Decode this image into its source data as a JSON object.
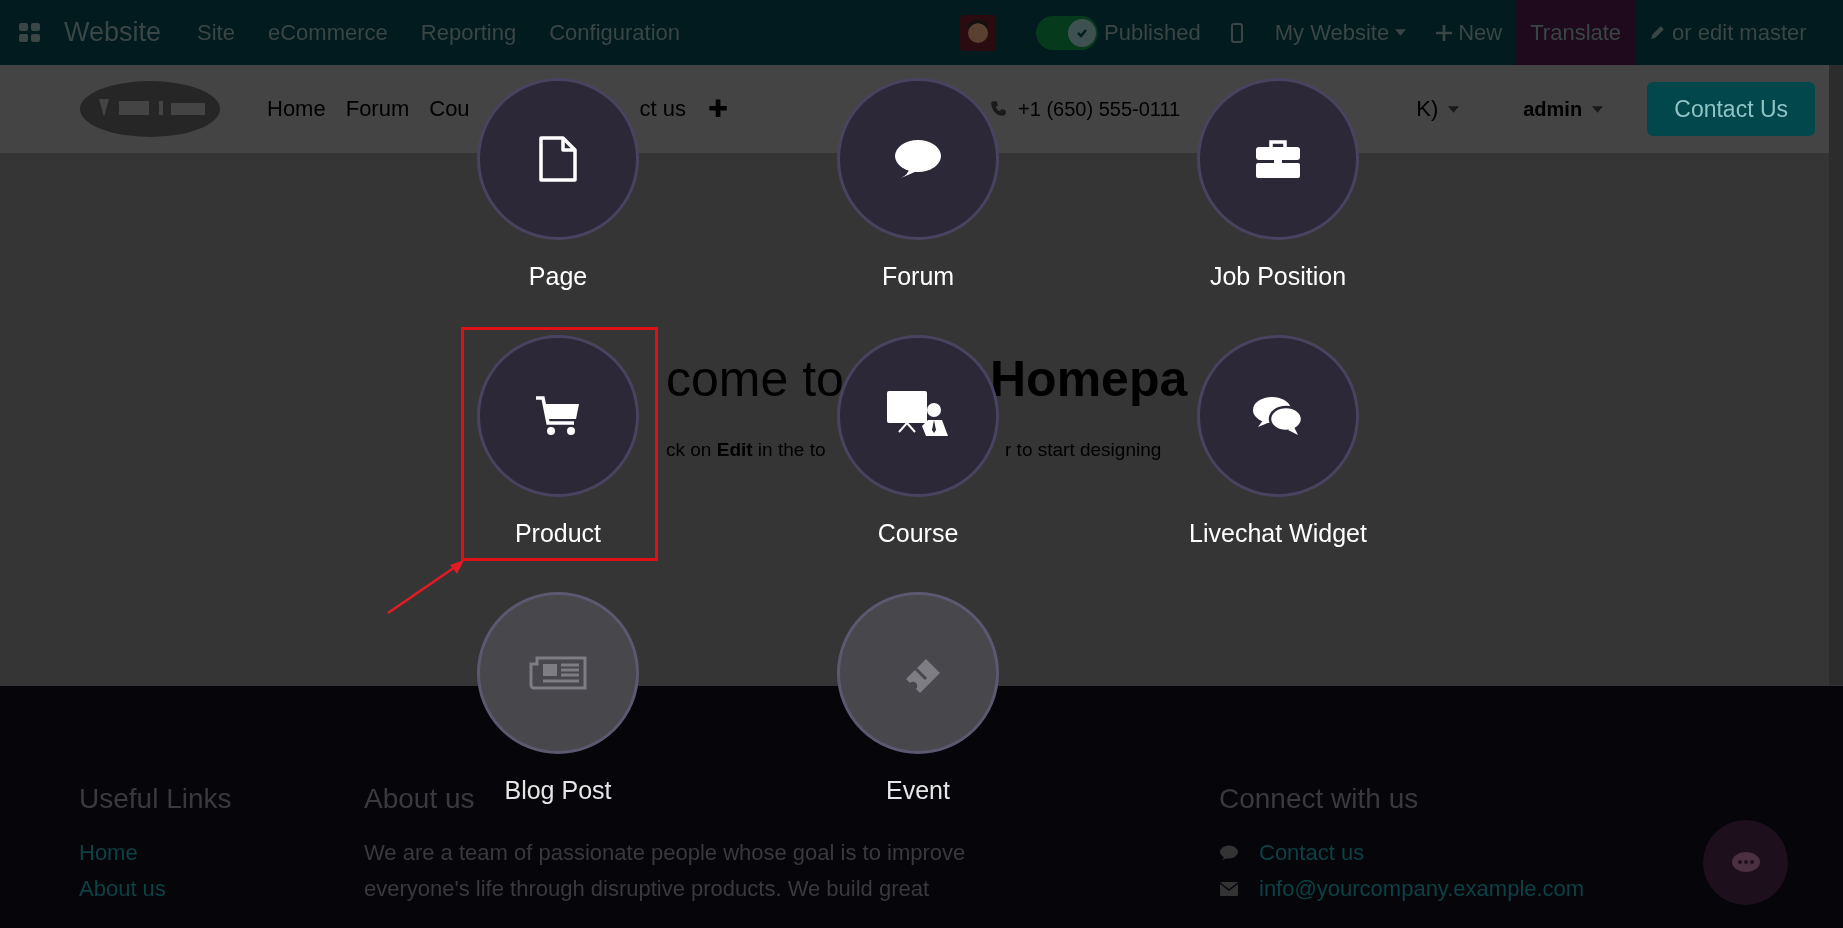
{
  "top_bar": {
    "app_name": "Website",
    "menu": [
      "Site",
      "eCommerce",
      "Reporting",
      "Configuration"
    ],
    "published": {
      "label": "Published",
      "on": true
    },
    "website_switcher": "My Website",
    "new_button": "New",
    "translate_button": "Translate",
    "edit_master_link": "or edit master"
  },
  "site_header": {
    "nav": [
      "Home",
      "Forum",
      "Cou",
      "ct us"
    ],
    "add_symbol": "✚",
    "phone": "+1 (650) 555-0111",
    "language_fragment": "K)",
    "user": "admin",
    "contact_button": "Contact Us"
  },
  "hero": {
    "title_fragments": [
      "come to",
      "Homepa"
    ],
    "subtitle_fragments": [
      "ck on **Edit** in the to",
      "r to start designing"
    ]
  },
  "new_content_menu": [
    {
      "label": "Page",
      "disabled": false,
      "highlighted": false
    },
    {
      "label": "Forum",
      "disabled": false,
      "highlighted": false
    },
    {
      "label": "Job Position",
      "disabled": false,
      "highlighted": false
    },
    {
      "label": "Product",
      "disabled": false,
      "highlighted": true
    },
    {
      "label": "Course",
      "disabled": false,
      "highlighted": false
    },
    {
      "label": "Livechat Widget",
      "disabled": false,
      "highlighted": false
    },
    {
      "label": "Blog Post",
      "disabled": true,
      "highlighted": false
    },
    {
      "label": "Event",
      "disabled": true,
      "highlighted": false
    }
  ],
  "footer": {
    "useful_links": {
      "title": "Useful Links",
      "links": [
        "Home",
        "About us"
      ]
    },
    "about": {
      "title": "About us",
      "text": "We are a team of passionate people whose goal is to improve everyone's life through disruptive products. We build great"
    },
    "connect": {
      "title": "Connect with us",
      "items": [
        "Contact us",
        "info@yourcompany.example.com"
      ]
    }
  }
}
